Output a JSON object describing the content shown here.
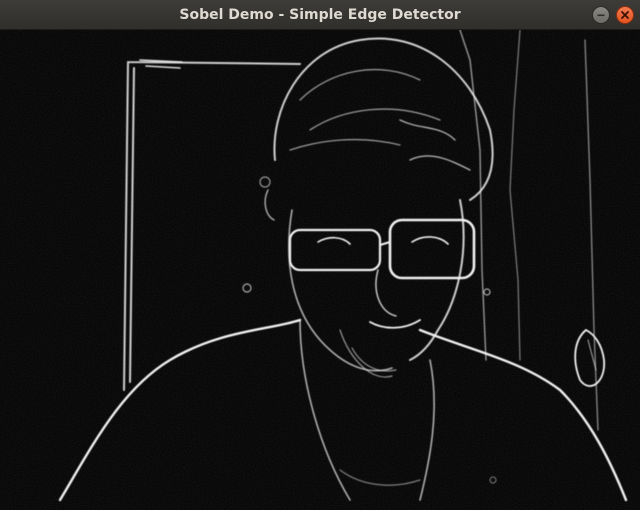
{
  "window": {
    "title": "Sobel Demo - Simple Edge Detector",
    "controls": [
      {
        "name": "minimize",
        "icon": "minimize-icon"
      },
      {
        "name": "close",
        "icon": "close-icon"
      }
    ]
  },
  "image": {
    "description_type": "sobel-edge-output",
    "background_color": "#000000",
    "edge_color": "#ffffff"
  }
}
